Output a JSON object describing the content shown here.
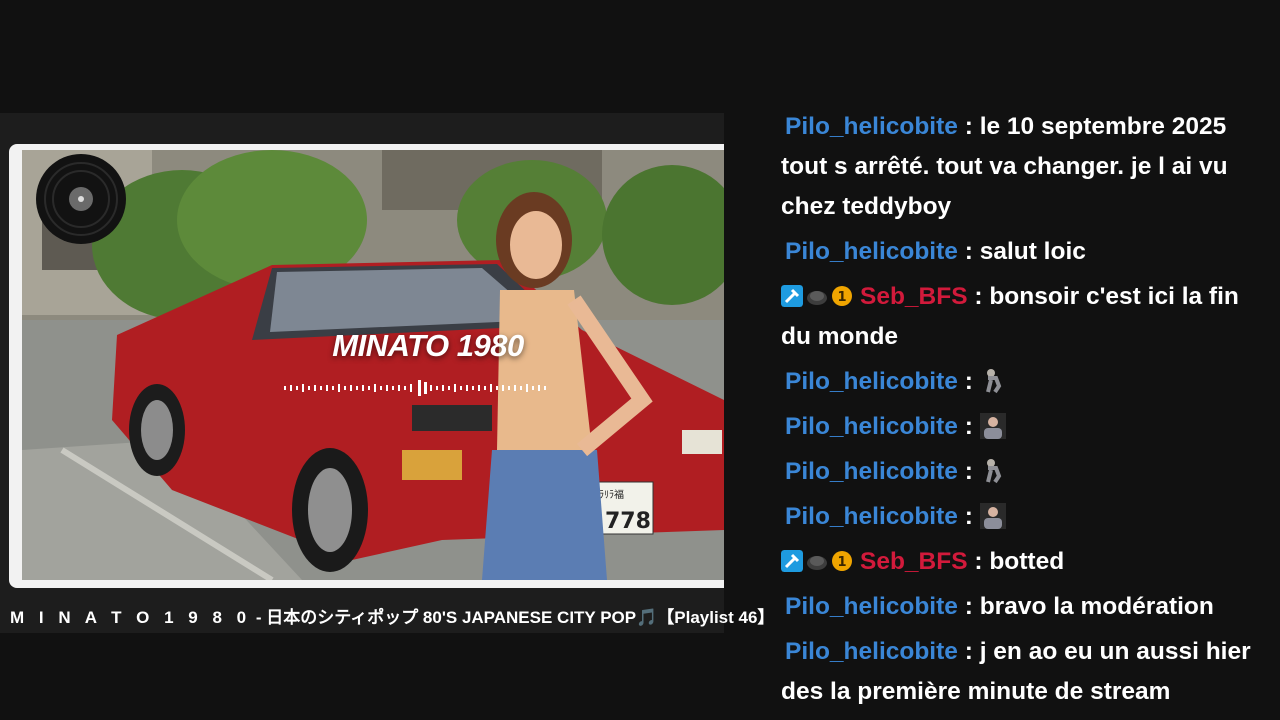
{
  "video": {
    "overlay_title": "MINATO 1980",
    "plate_text": "778",
    "plate_kana": "ｶﾗﾘﾗ福",
    "caption_part1": "M I N A T O   1 9 8 0",
    "caption_part2": " - 日本のシティポップ 80'S JAPANESE CITY POP",
    "caption_note": "🎵",
    "caption_part3": "【Playlist 46】"
  },
  "chat": {
    "messages": [
      {
        "user": "Pilo_helicobite",
        "sep": " : ",
        "text": "le 10 septembre 2025 tout s arrêté. tout va changer. je l ai vu chez teddyboy"
      },
      {
        "user": "Pilo_helicobite",
        "sep": " : ",
        "text": "salut loic"
      },
      {
        "user": "Seb_BFS",
        "sep": " : ",
        "text": "bonsoir c'est ici la fin du monde"
      },
      {
        "user": "Pilo_helicobite",
        "sep": " : ",
        "emote": "walking-figure-emote"
      },
      {
        "user": "Pilo_helicobite",
        "sep": " : ",
        "emote": "person-portrait-emote"
      },
      {
        "user": "Pilo_helicobite",
        "sep": " : ",
        "emote": "walking-figure-emote"
      },
      {
        "user": "Pilo_helicobite",
        "sep": " : ",
        "emote": "person-portrait-emote"
      },
      {
        "user": "Seb_BFS",
        "sep": " : ",
        "text": "botted"
      },
      {
        "user": "Pilo_helicobite",
        "sep": " : ",
        "text": "bravo la modération"
      },
      {
        "user": "Pilo_helicobite",
        "sep": " : ",
        "text": "j en ao eu un aussi hier des la première minute de stream"
      }
    ],
    "badge_number": "1",
    "colors": {
      "user_blue": "#3a86d6",
      "user_red": "#d21a3b",
      "text": "#ffffff",
      "background": "#111111"
    }
  }
}
